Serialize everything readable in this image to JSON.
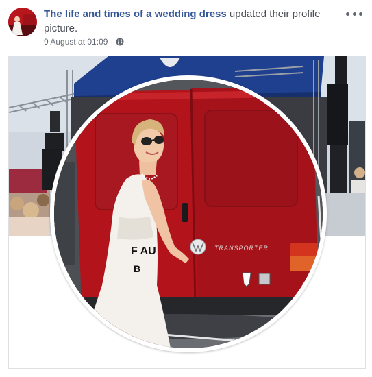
{
  "post": {
    "page_name": "The life and times of a wedding dress",
    "action_text": " updated their profile picture.",
    "date": "9 August at 01:09",
    "separator": "·",
    "privacy_icon": "globe-icon",
    "more_icon": "more-options-icon"
  },
  "van": {
    "plate_text": "F AU",
    "side_badge": "TRANSPORTER",
    "rear_letter": "B"
  },
  "colors": {
    "page_name": "#365899",
    "van_red": "#b3141c",
    "dress": "#f4f1ec"
  }
}
